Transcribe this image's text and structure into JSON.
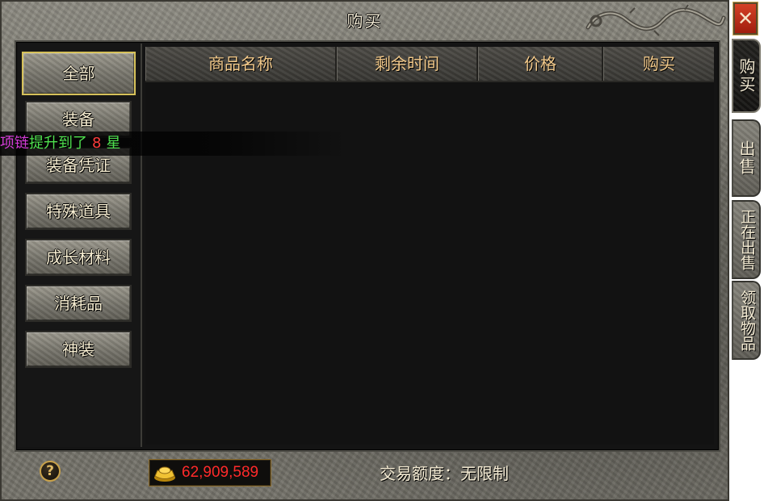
{
  "window": {
    "title": "购买",
    "close_label": "✕"
  },
  "categories": [
    {
      "label": "全部",
      "active": true
    },
    {
      "label": "装备"
    },
    {
      "label": "装备凭证"
    },
    {
      "label": "特殊道具"
    },
    {
      "label": "成长材料"
    },
    {
      "label": "消耗品"
    },
    {
      "label": "神装"
    }
  ],
  "table": {
    "columns": [
      "商品名称",
      "剩余时间",
      "价格",
      "购买"
    ],
    "rows": []
  },
  "broadcast": {
    "item": "项链",
    "middle": "提升到了",
    "number": "8",
    "suffix": "星"
  },
  "footer": {
    "help_label": "?",
    "gold_amount": "62,909,589",
    "trade_limit": "交易额度：无限制"
  },
  "side_tabs": [
    {
      "label": "购买",
      "active": true
    },
    {
      "label": "出售"
    },
    {
      "label": "正在出售"
    },
    {
      "label": "领取物品"
    }
  ],
  "colors": {
    "gold_text": "#ff2a2a",
    "header_text": "#f2c98a",
    "active_border": "#d6c15a",
    "broadcast_item": "#d23bd6",
    "broadcast_text": "#4ee04e",
    "broadcast_number": "#ff3b3b"
  },
  "icons": [
    "dragon-ornament-icon",
    "help-icon",
    "gold-ingot-icon",
    "close-icon"
  ]
}
